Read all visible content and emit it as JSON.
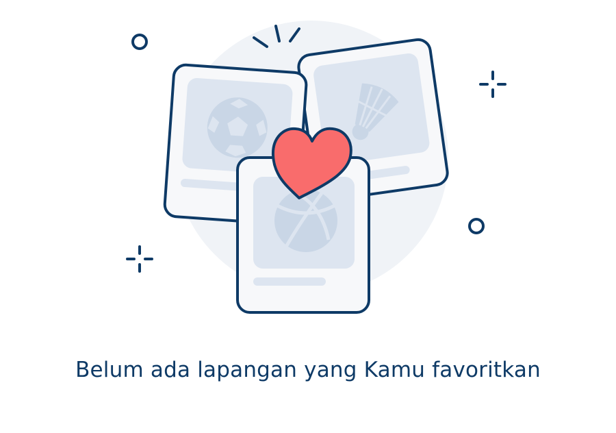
{
  "empty_state": {
    "message": "Belum ada lapangan yang Kamu favoritkan"
  },
  "illustration": {
    "cards": [
      {
        "sport": "soccer",
        "icon": "soccer-ball-icon"
      },
      {
        "sport": "badminton",
        "icon": "shuttlecock-icon"
      },
      {
        "sport": "basketball",
        "icon": "basketball-icon"
      }
    ],
    "badge_icon": "heart-icon"
  },
  "colors": {
    "outline": "#0e3a66",
    "card_fill": "#f7f8fa",
    "panel_fill": "#dde5f0",
    "icon_fill": "#c9d6e6",
    "heart": "#f96c6c",
    "backdrop": "#f0f3f7",
    "text": "#0e3a66"
  }
}
